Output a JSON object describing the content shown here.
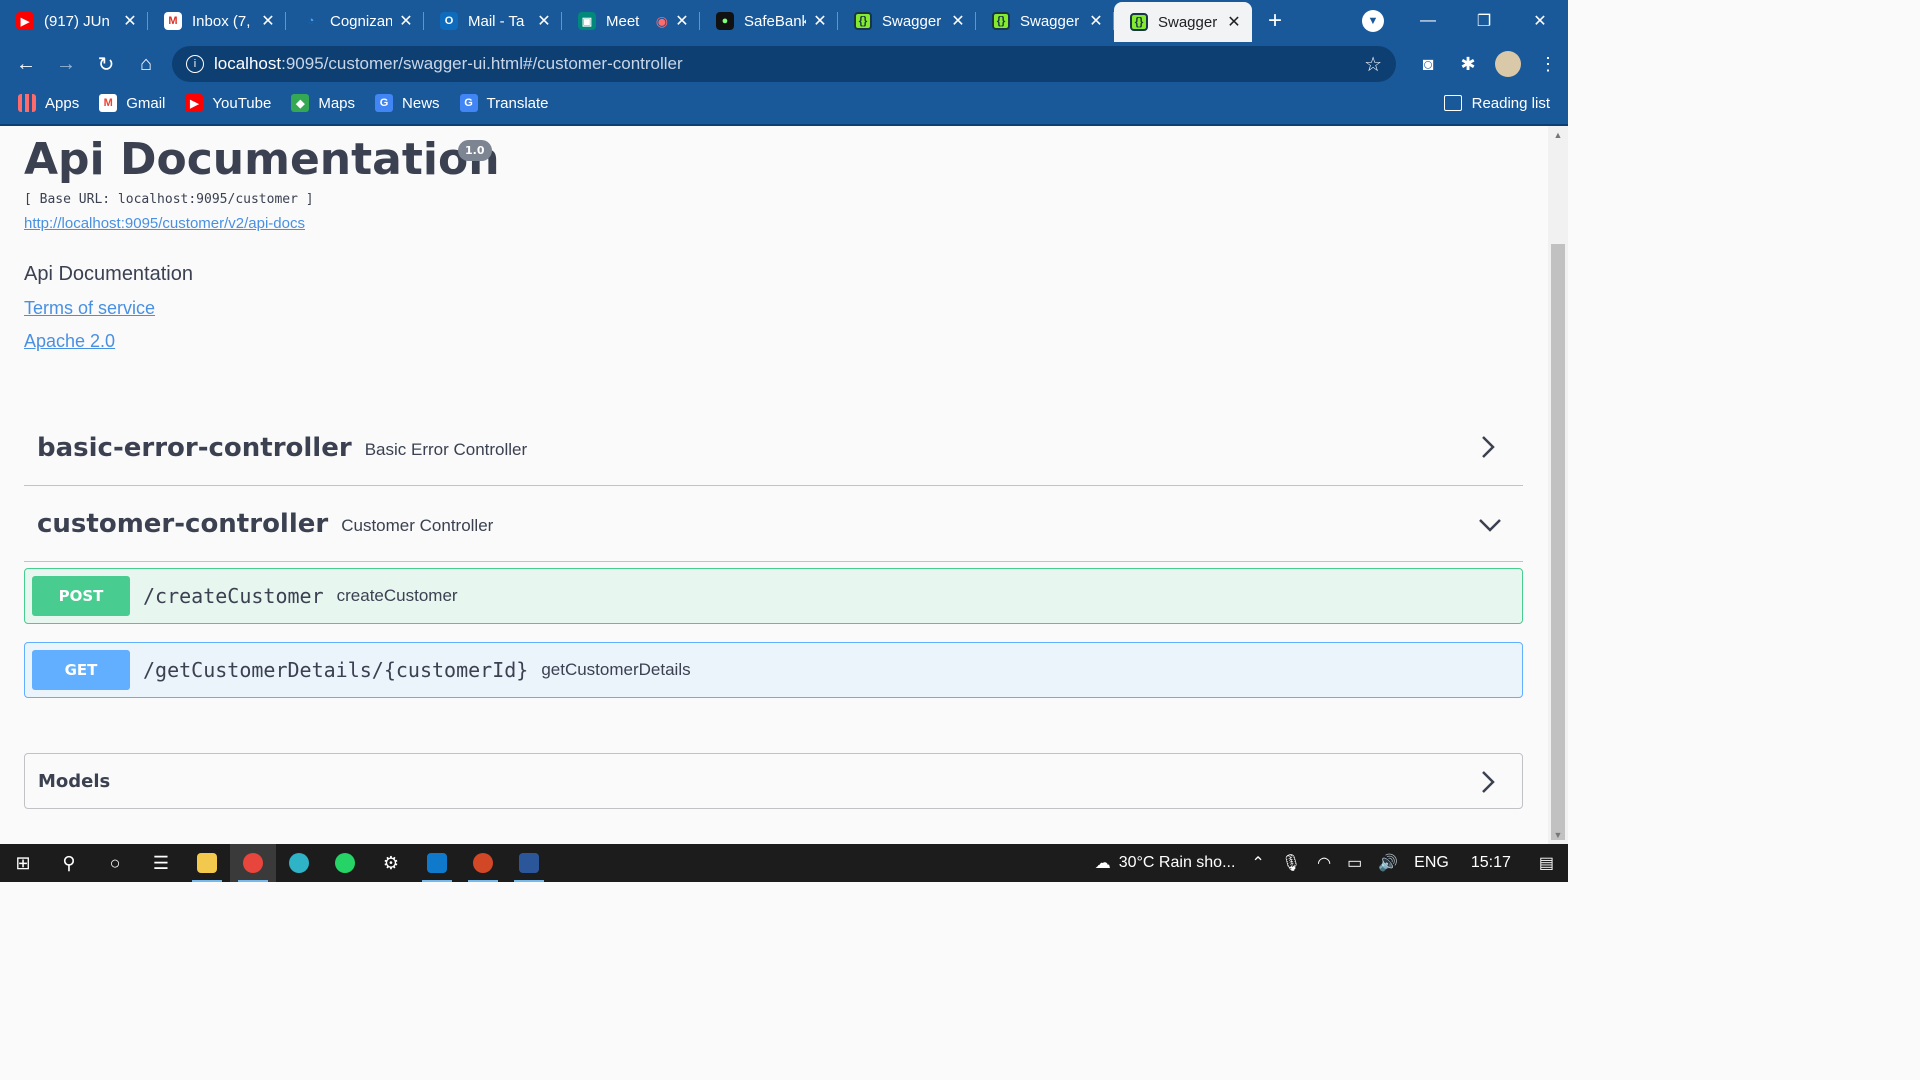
{
  "browser": {
    "tabs": [
      {
        "title": "(917) JUn",
        "favicon": "youtube-icon",
        "active": false
      },
      {
        "title": "Inbox (7,",
        "favicon": "gmail-icon",
        "active": false
      },
      {
        "title": "Cognizan",
        "favicon": "cognizant-icon",
        "active": false
      },
      {
        "title": "Mail - Ta",
        "favicon": "outlook-icon",
        "active": false
      },
      {
        "title": "Meet",
        "favicon": "meet-icon",
        "active": false
      },
      {
        "title": "SafeBank",
        "favicon": "safebank-icon",
        "active": false
      },
      {
        "title": "Swagger",
        "favicon": "swagger-icon",
        "active": false
      },
      {
        "title": "Swagger",
        "favicon": "swagger-icon",
        "active": false
      },
      {
        "title": "Swagger",
        "favicon": "swagger-icon",
        "active": true
      }
    ],
    "address": {
      "host": "localhost",
      "path": ":9095/customer/swagger-ui.html#/customer-controller"
    },
    "bookmarks": [
      "Apps",
      "Gmail",
      "YouTube",
      "Maps",
      "News",
      "Translate"
    ],
    "reading_list": "Reading list"
  },
  "page": {
    "title": "Api Documentation",
    "version": "1.0",
    "base_url": "[ Base URL: localhost:9095/customer ]",
    "docs_link": "http://localhost:9095/customer/v2/api-docs",
    "description": "Api Documentation",
    "terms_link": "Terms of service",
    "license_link": "Apache 2.0",
    "tags": [
      {
        "name": "basic-error-controller",
        "description": "Basic Error Controller",
        "expanded": false
      },
      {
        "name": "customer-controller",
        "description": "Customer Controller",
        "expanded": true
      }
    ],
    "operations": [
      {
        "method": "POST",
        "path": "/createCustomer",
        "summary": "createCustomer",
        "color": "#49cc90"
      },
      {
        "method": "GET",
        "path": "/getCustomerDetails/{customerId}",
        "summary": "getCustomerDetails",
        "color": "#61affe"
      }
    ],
    "models_label": "Models"
  },
  "taskbar": {
    "weather": "30°C  Rain sho...",
    "language": "ENG",
    "time": "15:17"
  },
  "colors": {
    "chrome": "#19599a",
    "post": "#49cc90",
    "get": "#61affe",
    "link": "#4990e2",
    "text": "#3b4151"
  }
}
